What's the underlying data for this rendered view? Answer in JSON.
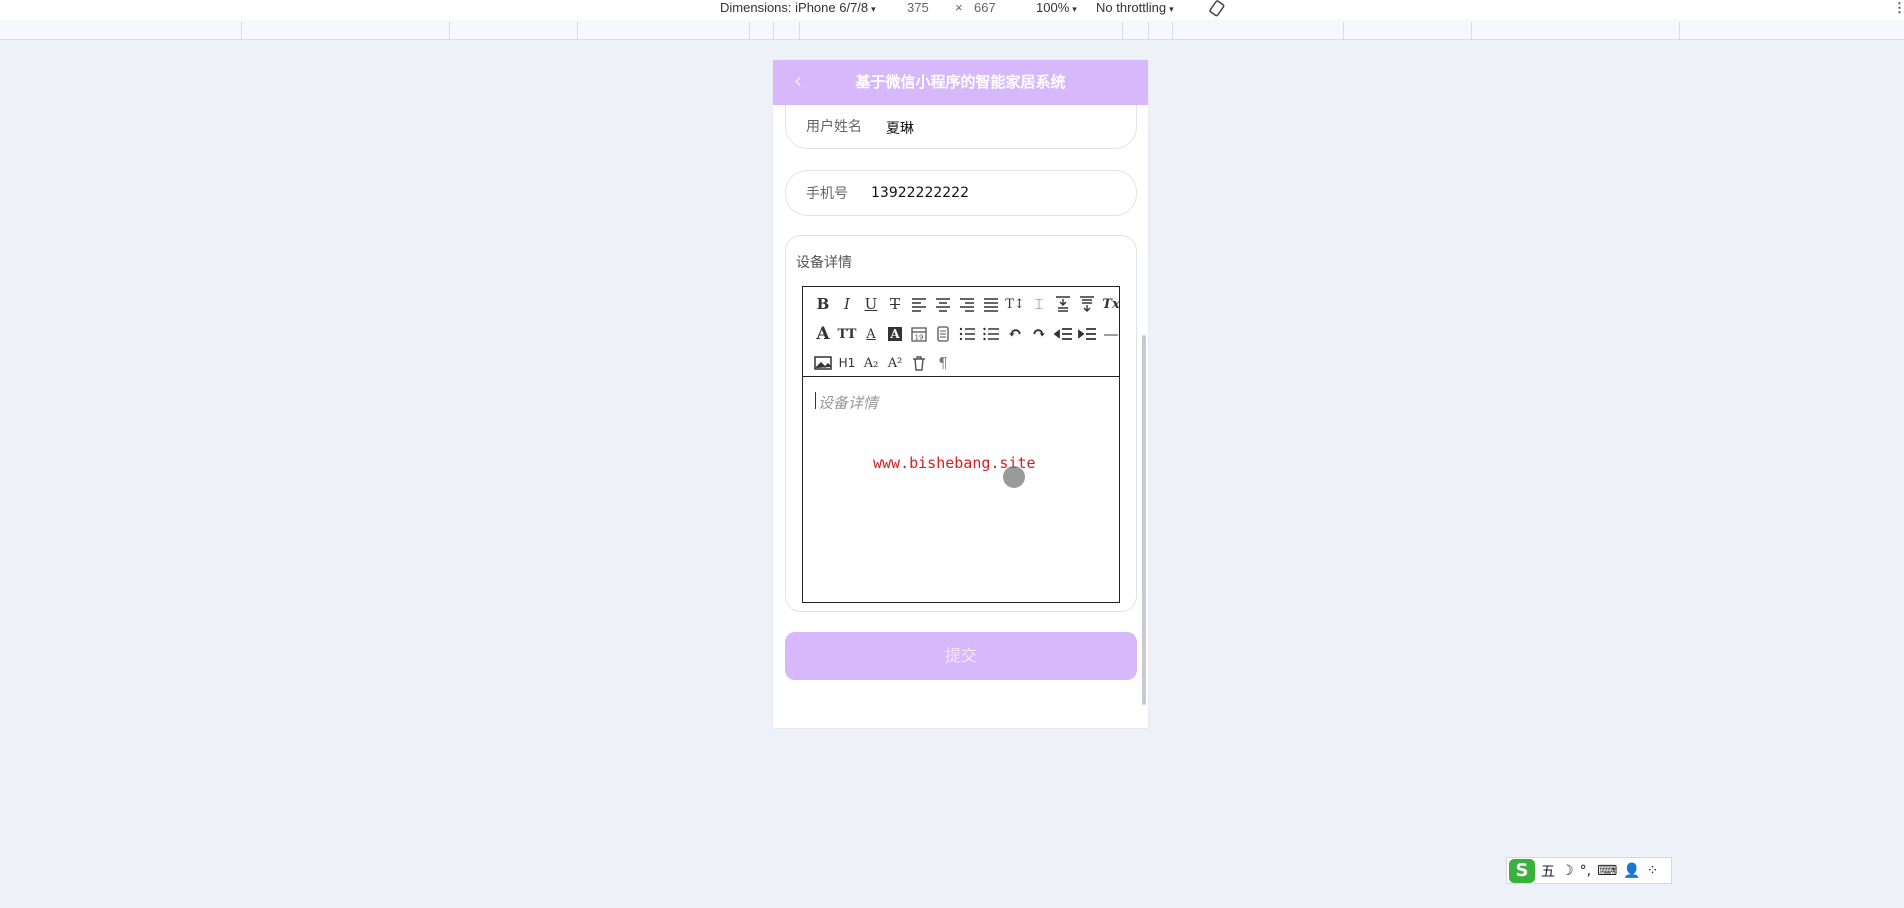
{
  "devtools": {
    "dimensions_label": "Dimensions: iPhone 6/7/8",
    "width": "375",
    "times": "×",
    "height": "667",
    "zoom": "100%",
    "throttling": "No throttling",
    "caret": "▾",
    "more": "⋮"
  },
  "nav": {
    "back_glyph": "‹",
    "title": "基于微信小程序的智能家居系统"
  },
  "form": {
    "username_label": "用户姓名",
    "username_value": "夏琳",
    "phone_label": "手机号",
    "phone_value": "13922222222",
    "detail_label": "设备详情",
    "editor_placeholder": "设备详情",
    "watermark": "www.bishebang.site",
    "submit_label": "提交"
  },
  "toolbar": {
    "row1": [
      {
        "name": "bold",
        "glyph": "B"
      },
      {
        "name": "italic",
        "glyph": "I"
      },
      {
        "name": "underline",
        "glyph": "U"
      },
      {
        "name": "strikethrough",
        "glyph": "T"
      },
      {
        "name": "align-left",
        "glyph": ""
      },
      {
        "name": "align-center",
        "glyph": ""
      },
      {
        "name": "align-right",
        "glyph": ""
      },
      {
        "name": "align-justify",
        "glyph": ""
      },
      {
        "name": "line-height",
        "glyph": "T↕"
      },
      {
        "name": "letter-spacing",
        "glyph": "⌶"
      },
      {
        "name": "margin-top",
        "glyph": ""
      },
      {
        "name": "margin-bottom",
        "glyph": ""
      },
      {
        "name": "clear-format",
        "glyph": "Tx"
      }
    ],
    "row2": [
      {
        "name": "font-family",
        "glyph": "A"
      },
      {
        "name": "font-size",
        "glyph": "TT"
      },
      {
        "name": "font-color",
        "glyph": "A"
      },
      {
        "name": "background-color",
        "glyph": "A"
      },
      {
        "name": "date",
        "glyph": "19"
      },
      {
        "name": "checklist",
        "glyph": ""
      },
      {
        "name": "ordered-list",
        "glyph": ""
      },
      {
        "name": "bullet-list",
        "glyph": ""
      },
      {
        "name": "undo",
        "glyph": "↶"
      },
      {
        "name": "redo",
        "glyph": "↷"
      },
      {
        "name": "outdent",
        "glyph": ""
      },
      {
        "name": "indent",
        "glyph": ""
      },
      {
        "name": "divider",
        "glyph": "—"
      }
    ],
    "row3": [
      {
        "name": "image",
        "glyph": ""
      },
      {
        "name": "heading",
        "glyph": "H1"
      },
      {
        "name": "subscript",
        "glyph": "A₂"
      },
      {
        "name": "superscript",
        "glyph": "A²"
      },
      {
        "name": "delete",
        "glyph": ""
      },
      {
        "name": "paragraph",
        "glyph": "¶"
      }
    ]
  },
  "ime": {
    "logo": "S",
    "mode": "五",
    "items": [
      "☽",
      "°,",
      "⌨",
      "👤",
      "⁘"
    ]
  }
}
